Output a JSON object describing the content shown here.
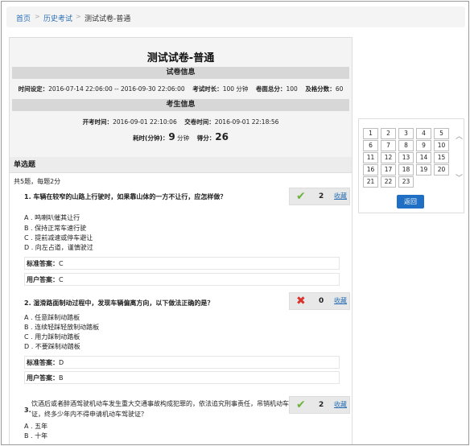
{
  "breadcrumb": {
    "home": "首页",
    "history": "历史考试",
    "current": "测试试卷-普通",
    "separator": ">"
  },
  "exam": {
    "title": "测试试卷-普通",
    "paper_info_heading": "试卷信息",
    "time_limit_label": "时间设定：",
    "time_limit_value": "2016-07-14 22:06:00 -- 2016-09-30 22:06:00",
    "duration_label": "考试时长：",
    "duration_value": "100 分钟",
    "total_score_label": "卷面总分：",
    "total_score_value": "100",
    "pass_score_label": "及格分数：",
    "pass_score_value": "60",
    "taker_info_heading": "考生信息",
    "start_label": "开考时间：",
    "start_value": "2016-09-01 22:10:06",
    "submit_label": "交卷时间：",
    "submit_value": "2016-09-01 22:18:56",
    "elapsed_label": "耗时(分钟)：",
    "elapsed_value": "9",
    "elapsed_unit": "分钟",
    "score_label": "得分：",
    "score_value": "26"
  },
  "section": {
    "heading": "单选题",
    "summary": "共5题，每题2分"
  },
  "questions": [
    {
      "number": "1.",
      "text": "车辆在较窄的山路上行驶时，如果靠山体的一方不让行，应怎样做？",
      "options": [
        "A . 鸣喇叭催其让行",
        "B . 保持正常车速行驶",
        "C . 提前减速或停车避让",
        "D . 向左占道，谨慎驶过"
      ],
      "std_label": "标准答案：",
      "std_answer": "C",
      "user_label": "用户答案：",
      "user_answer": "C",
      "result": "correct",
      "score": "2",
      "fav": "收藏"
    },
    {
      "number": "2.",
      "text": "湿滑路面制动过程中，发现车辆偏离方向，以下做法正确的是？",
      "options": [
        "A . 任意踩制动踏板",
        "B . 连续轻踩轻放制动踏板",
        "C . 用力踩制动踏板",
        "D . 不要踩制动踏板"
      ],
      "std_label": "标准答案：",
      "std_answer": "D",
      "user_label": "用户答案：",
      "user_answer": "B",
      "result": "wrong",
      "score": "0",
      "fav": "收藏"
    },
    {
      "number": "3.",
      "text_line1": "饮酒后或者醉酒驾驶机动车发生重大交通事故构成犯罪的，依法追究刑事责任，吊销机动车驾驶",
      "text_line2": "证，终多少年内不得申请机动车驾驶证？",
      "options": [
        "A . 五年",
        "B . 十年"
      ],
      "result": "correct",
      "score": "2",
      "fav": "收藏"
    }
  ],
  "navigator": {
    "numbers": [
      "1",
      "2",
      "3",
      "4",
      "5",
      "6",
      "7",
      "8",
      "9",
      "10",
      "11",
      "12",
      "13",
      "14",
      "15",
      "16",
      "17",
      "18",
      "19",
      "20",
      "21",
      "22",
      "23"
    ],
    "back_label": "返回"
  },
  "icons": {
    "correct": "check-icon",
    "wrong": "cross-icon"
  },
  "colors": {
    "link": "#2a6fb6",
    "correct": "#6cb33e",
    "wrong": "#d9322c",
    "button": "#1f6fc5"
  }
}
